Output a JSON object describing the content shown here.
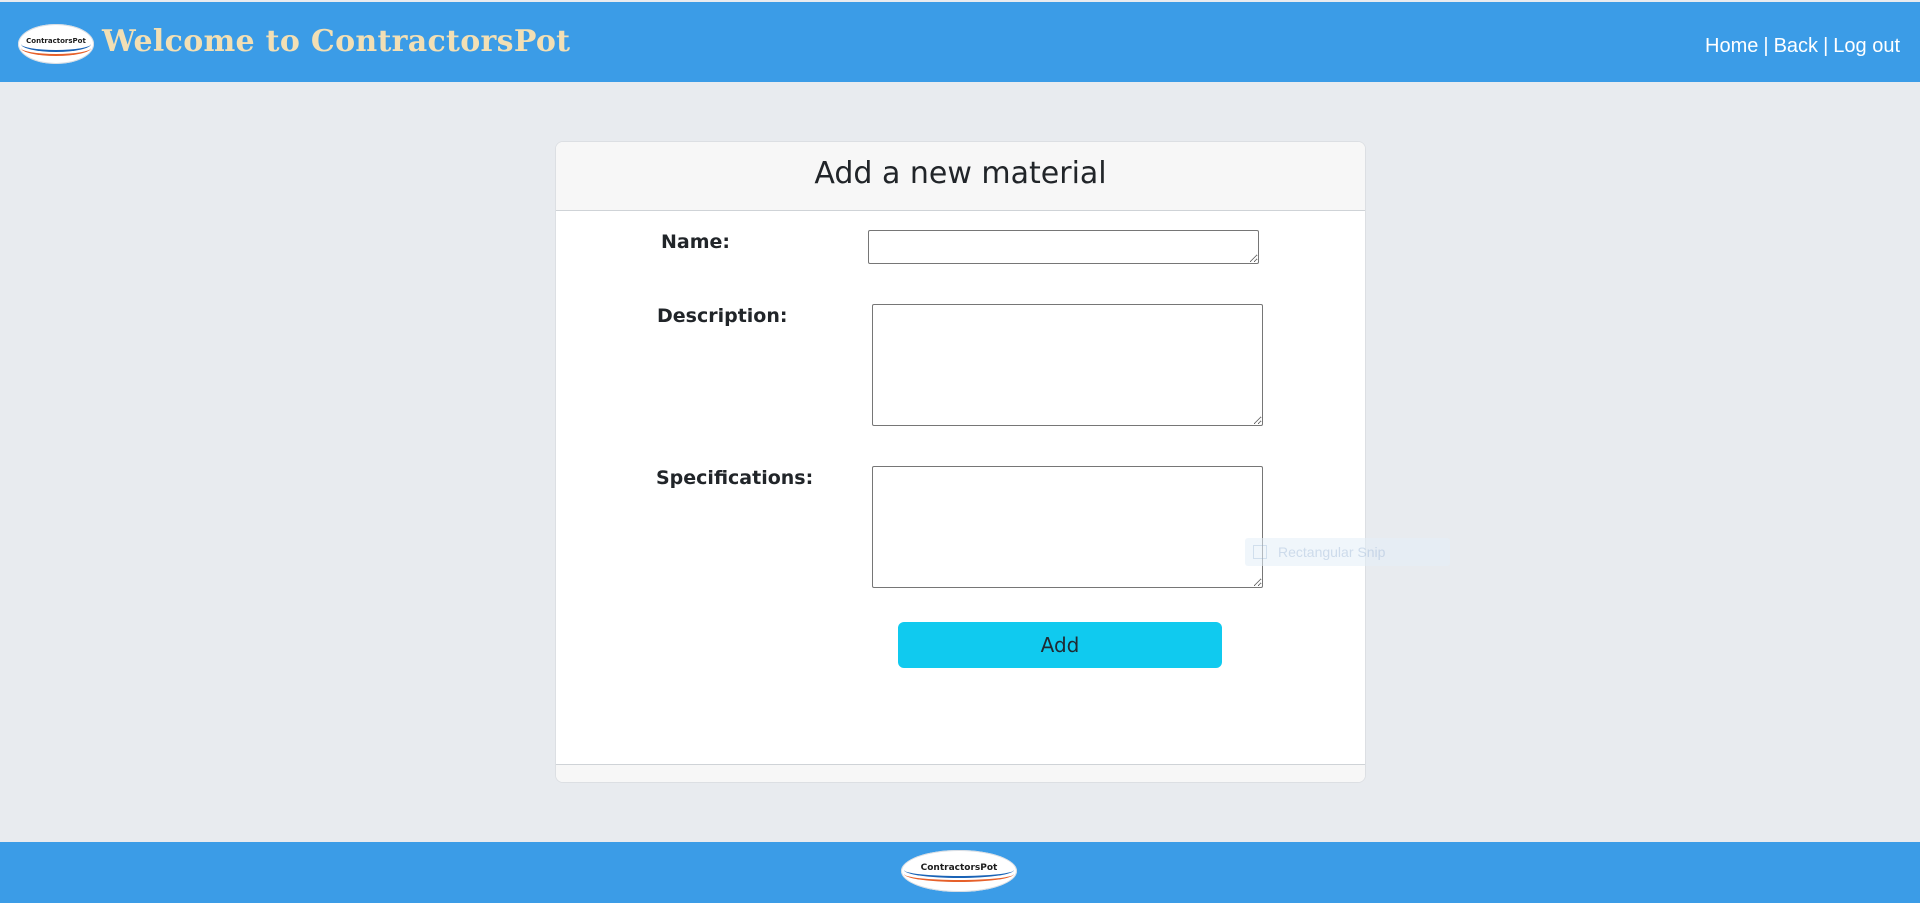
{
  "header": {
    "logo_text": "ContractorsPot",
    "title": "Welcome to ContractorsPot",
    "nav": [
      {
        "label": "Home"
      },
      {
        "label": "Back"
      },
      {
        "label": "Log out"
      }
    ],
    "separator": "|"
  },
  "card": {
    "title": "Add a new material",
    "fields": {
      "name": {
        "label": "Name:",
        "value": ""
      },
      "description": {
        "label": "Description:",
        "value": ""
      },
      "specifications": {
        "label": "Specifications:",
        "value": ""
      }
    },
    "submit_label": "Add"
  },
  "ghost_tooltip": {
    "text": "Rectangular Snip"
  },
  "footer": {
    "logo_text": "ContractorsPot"
  },
  "colors": {
    "header_bg": "#3b9ce7",
    "title_text": "#f2dfb4",
    "page_bg": "#e8ebef",
    "button_bg": "#10caef"
  }
}
